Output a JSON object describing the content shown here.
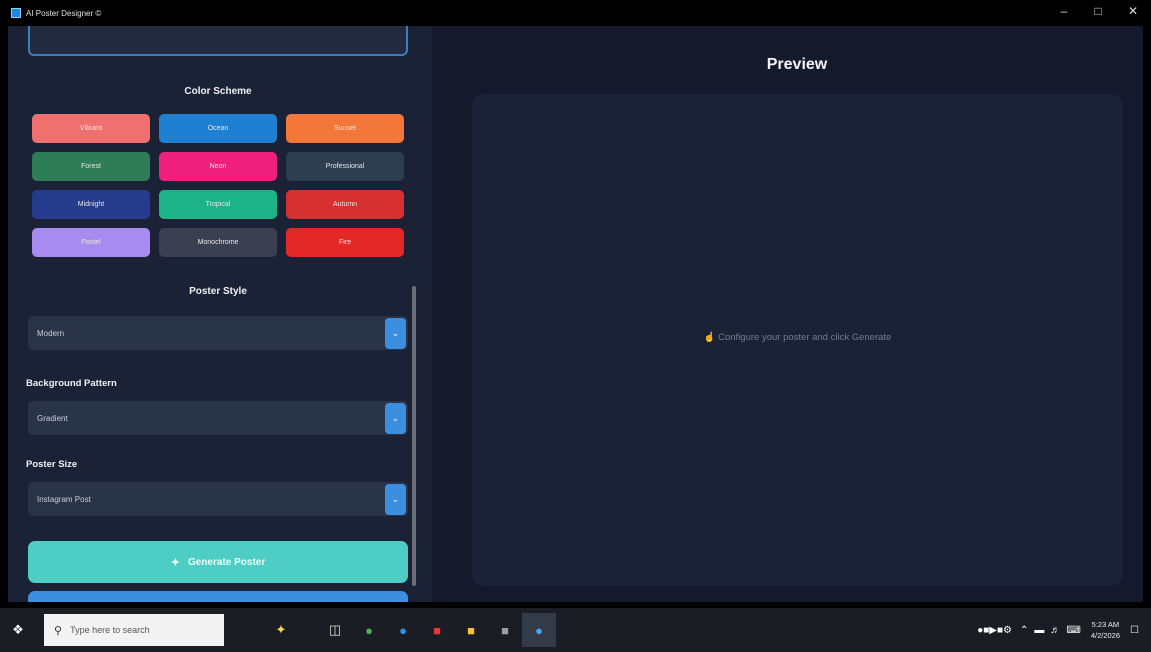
{
  "window": {
    "title": "AI Poster Designer ©",
    "minimize": "–",
    "maximize": "□",
    "close": "✕"
  },
  "sidebar": {
    "color_scheme_title": "Color Scheme",
    "color_schemes": [
      {
        "label": "Vibrant",
        "color": "#f07070"
      },
      {
        "label": "Ocean",
        "color": "#1f7fd0"
      },
      {
        "label": "Sunset",
        "color": "#f4773a"
      },
      {
        "label": "Forest",
        "color": "#2e7d57"
      },
      {
        "label": "Neon",
        "color": "#ef1f7d"
      },
      {
        "label": "Professional",
        "color": "#2c3e50"
      },
      {
        "label": "Midnight",
        "color": "#253b8c"
      },
      {
        "label": "Tropical",
        "color": "#1cb487"
      },
      {
        "label": "Autumn",
        "color": "#d73030"
      },
      {
        "label": "Pastel",
        "color": "#a88bf0"
      },
      {
        "label": "Monochrome",
        "color": "#3a4052"
      },
      {
        "label": "Fire",
        "color": "#e42727"
      }
    ],
    "poster_style_title": "Poster Style",
    "poster_style_value": "Modern",
    "background_pattern_label": "Background Pattern",
    "background_pattern_value": "Gradient",
    "poster_size_label": "Poster Size",
    "poster_size_value": "Instagram Post",
    "generate_icon": "✦",
    "generate_label": "Generate Poster"
  },
  "preview": {
    "title": "Preview",
    "hint": "☝ Configure your poster and click Generate"
  },
  "taskbar": {
    "search_placeholder": "Type here to search",
    "time": "5:23 AM",
    "date": "4/2/2026"
  },
  "colors": {
    "accent": "#3b8fde",
    "generate": "#4ecdc4",
    "panel": "#1c2235",
    "preview_bg": "#141a2b"
  }
}
